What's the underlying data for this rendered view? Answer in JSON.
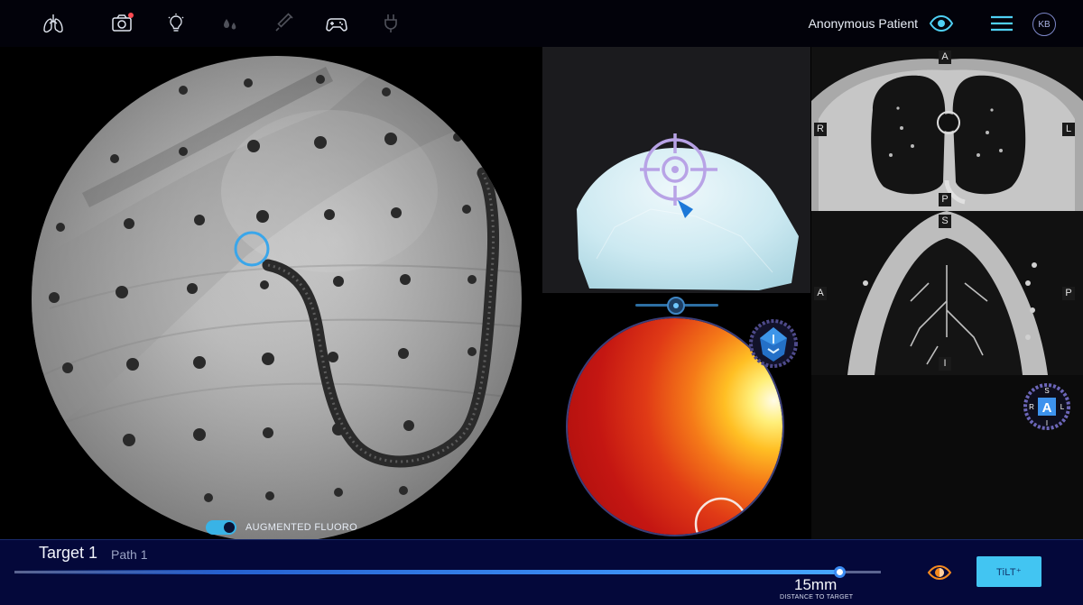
{
  "topbar": {
    "icons": [
      "lungs-icon",
      "camera-icon",
      "lightbulb-icon",
      "drops-icon",
      "syringe-icon",
      "gamepad-icon",
      "plug-icon"
    ],
    "patient_name": "Anonymous Patient",
    "avatar_initials": "KB",
    "accent_color": "#4fd0f4"
  },
  "fluoro": {
    "augmented_label": "AUGMENTED FLUORO",
    "augmented_enabled": true
  },
  "ct": {
    "axial_labels": {
      "top": "A",
      "bottom": "P",
      "left": "R",
      "right": "L"
    },
    "coronal_labels": {
      "top": "S",
      "bottom": "I",
      "left": "A",
      "right": "P"
    },
    "orientation_cube": {
      "top": "S",
      "bottom": "I",
      "left": "R",
      "right": "L",
      "face": "A"
    }
  },
  "bottom": {
    "target": "Target 1",
    "path": "Path 1",
    "distance": "15mm",
    "distance_label": "DISTANCE TO TARGET",
    "tilt_label": "TiLT⁺"
  },
  "colors": {
    "bottom_bar": "#04083a",
    "progress_blue": "#3a8bf2",
    "tilt_button": "#42c5f2",
    "orange_eye": "#f58a1f"
  }
}
